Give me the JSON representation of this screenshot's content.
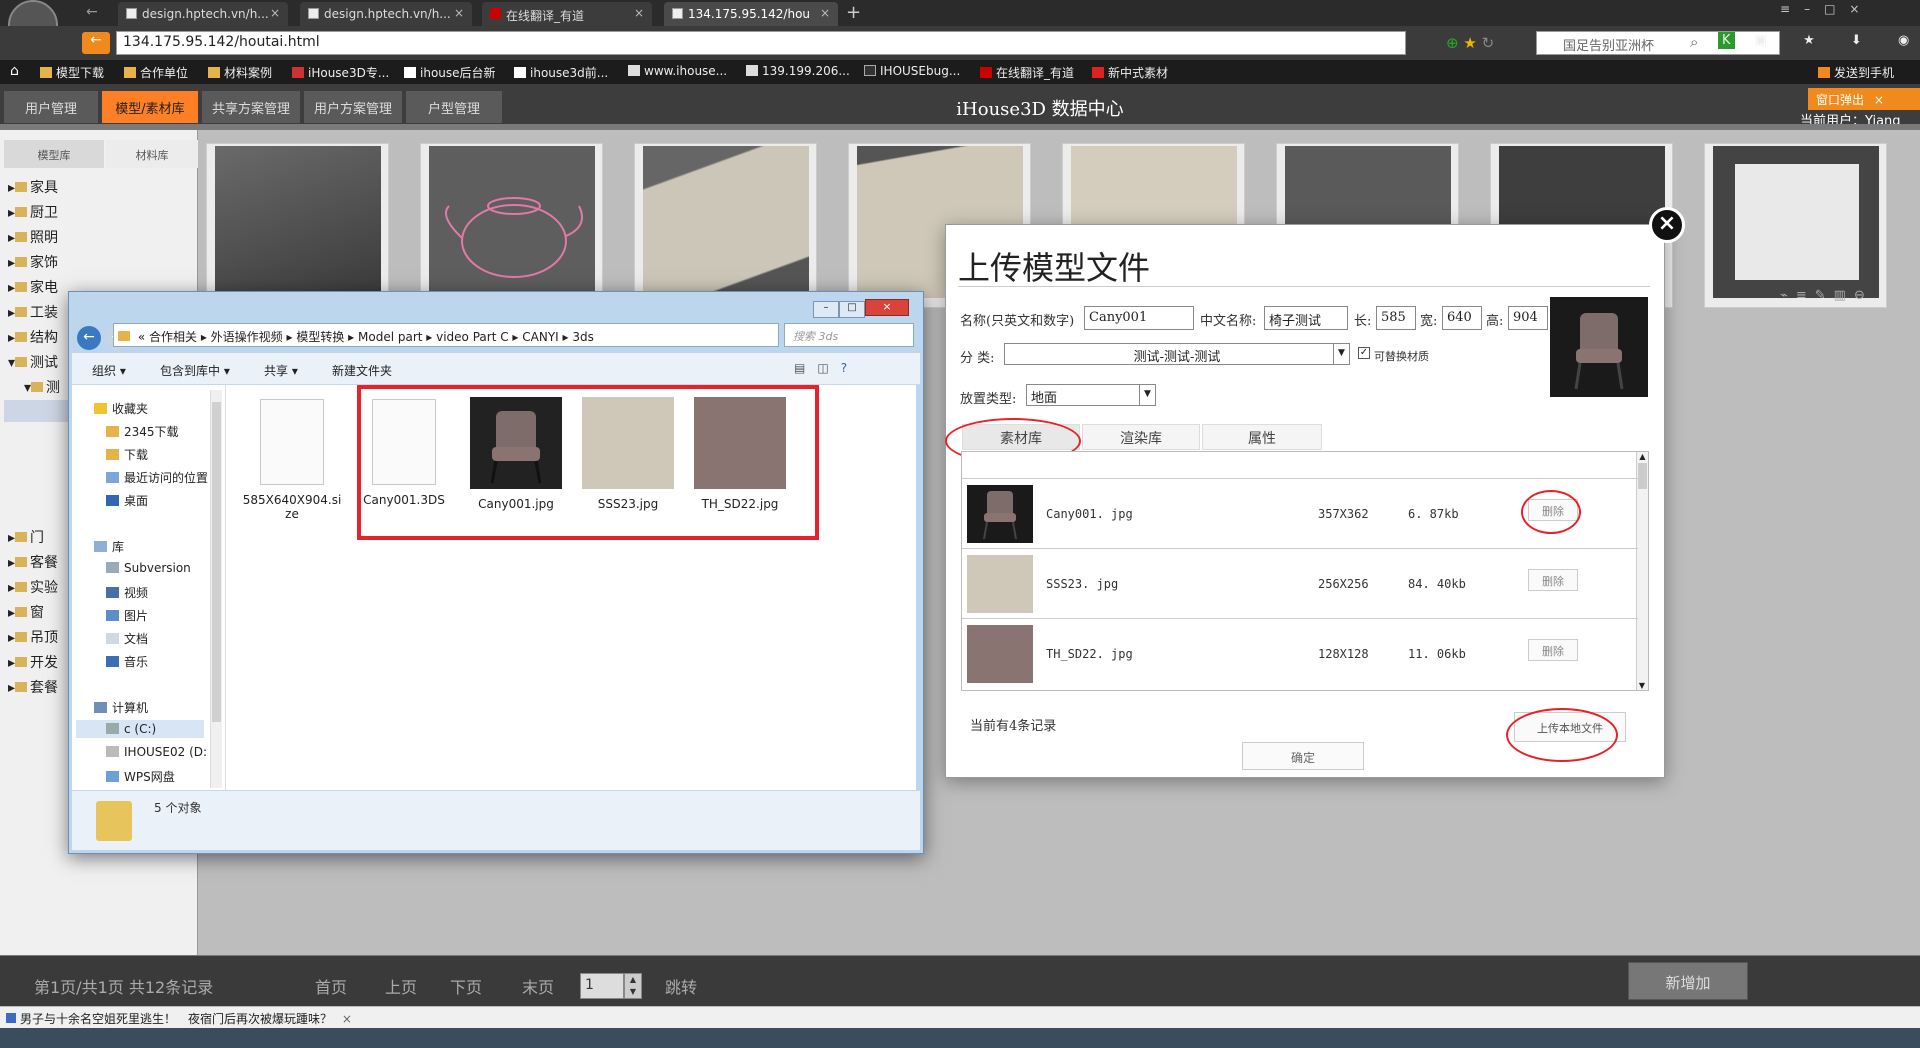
{
  "browser": {
    "tabs": [
      {
        "label": "design.hptech.vn/h..."
      },
      {
        "label": "design.hptech.vn/h..."
      },
      {
        "label": "在线翻译_有道"
      },
      {
        "label": "134.175.95.142/hou"
      }
    ],
    "url": "134.175.95.142/houtai.html",
    "search_text": "国足告别亚洲杯",
    "bookmarks": [
      "模型下载",
      "合作单位",
      "材料案例",
      "iHouse3D专...",
      "ihouse后台新",
      "ihouse3d前...",
      "www.ihouse...",
      "139.199.206...",
      "IHOUSEbug...",
      "在线翻译_有道",
      "新中式素材"
    ],
    "send_to_phone": "发送到手机",
    "popup_window": "窗口弹出"
  },
  "app": {
    "title": "iHouse3D 数据中心",
    "nav_tabs": [
      "用户管理",
      "模型/素材库",
      "共享方案管理",
      "用户方案管理",
      "户型管理"
    ],
    "user_text": "当前用户：Yiang",
    "lib_tabs": [
      "模型库",
      "材料库"
    ],
    "tree": [
      "家具",
      "厨卫",
      "照明",
      "家饰",
      "家电",
      "工装",
      "结构",
      "测试",
      "门",
      "客餐",
      "实验",
      "窗",
      "吊顶",
      "开发",
      "套餐"
    ],
    "tree_sub": "测"
  },
  "footer": {
    "page_info": "第1页/共1页 共12条记录",
    "first": "首页",
    "prev": "上页",
    "next": "下页",
    "last": "末页",
    "page_value": "1",
    "goto": "跳转",
    "new_button": "新增加"
  },
  "statusbar": {
    "items": [
      "男子与十余名空姐死里逃生！",
      "夜宿门后再次被爆玩踵味？"
    ]
  },
  "explorer": {
    "path": [
      "«",
      "合作相关",
      "外语操作视频",
      "模型转换",
      "Model part",
      "video Part C",
      "CANYI",
      "3ds"
    ],
    "search_placeholder": "搜索 3ds",
    "toolbar": [
      "组织 ▾",
      "包含到库中 ▾",
      "共享 ▾",
      "新建文件夹"
    ],
    "nav": {
      "favorites": "收藏夹",
      "fav_items": [
        "2345下载",
        "下载",
        "最近访问的位置",
        "桌面"
      ],
      "libraries": "库",
      "lib_items": [
        "Subversion",
        "视频",
        "图片",
        "文档",
        "音乐"
      ],
      "computer": "计算机",
      "computer_items": [
        "c (C:)",
        "IHOUSE02 (D:",
        "WPS网盘"
      ]
    },
    "files": [
      {
        "name": "585X640X904.size",
        "type": "doc"
      },
      {
        "name": "Cany001.3DS",
        "type": "doc"
      },
      {
        "name": "Cany001.jpg",
        "type": "chair"
      },
      {
        "name": "SSS23.jpg",
        "type": "fabric"
      },
      {
        "name": "TH_SD22.jpg",
        "type": "mauve"
      }
    ],
    "status": "5 个对象"
  },
  "upload": {
    "title": "上传模型文件",
    "name_label": "名称(只英文和数字)",
    "name_value": "Cany001",
    "cn_label": "中文名称:",
    "cn_value": "椅子测试",
    "len_label": "长:",
    "len_value": "585",
    "wid_label": "宽:",
    "wid_value": "640",
    "hgt_label": "高:",
    "hgt_value": "904",
    "category_label": "分  类:",
    "category_value": "测试-测试-测试",
    "replaceable_label": "可替换材质",
    "place_label": "放置类型:",
    "place_value": "地面",
    "tabs": [
      "素材库",
      "渲染库",
      "属性"
    ],
    "rows": [
      {
        "name": "Cany001. jpg",
        "size": "357X362",
        "filesize": "6. 87kb",
        "action": "删除",
        "thumb": "chair"
      },
      {
        "name": "SSS23. jpg",
        "size": "256X256",
        "filesize": "84. 40kb",
        "action": "删除",
        "thumb": "fabric"
      },
      {
        "name": "TH_SD22. jpg",
        "size": "128X128",
        "filesize": "11. 06kb",
        "action": "删除",
        "thumb": "mauve"
      }
    ],
    "record_count": "当前有4条记录",
    "upload_local": "上传本地文件",
    "confirm": "确定"
  },
  "colors": {
    "accent": "#ff7f27",
    "annotation": "#e8222b",
    "mauve": "#8a7472",
    "fabric": "#cfc8b8"
  }
}
